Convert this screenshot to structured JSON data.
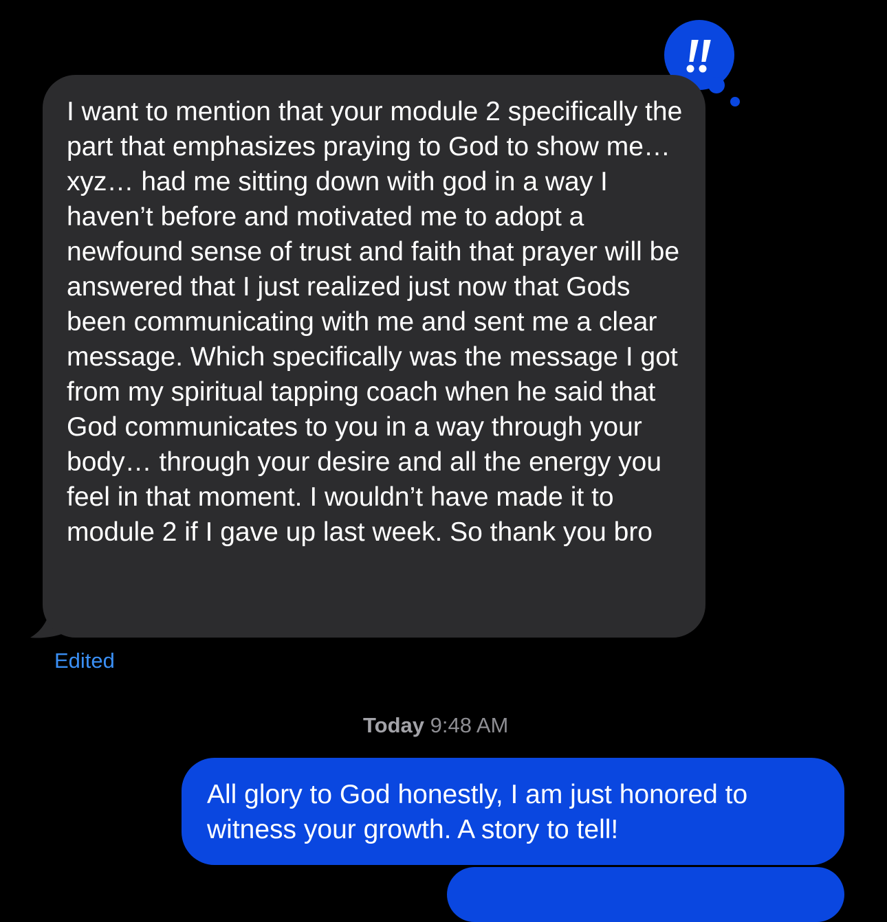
{
  "conversation": {
    "incoming_message": {
      "text": "I want to mention that your module 2 specifically the part that emphasizes praying to God to show me… xyz… had me sitting down with god in a way I haven’t before and motivated me to adopt a newfound sense of trust and faith that prayer will be answered that I just realized just now that Gods been communicating with me and sent me a clear message. Which specifically was the message I got from my spiritual tapping coach when he said that God communicates to you in a way through your body… through your desire and all the energy you feel in that moment. I wouldn’t have made it to module 2 if I gave up last week. So thank you bro",
      "bubble_color": "#2c2c2e",
      "reaction": {
        "icon": "double-exclamation-icon",
        "color": "#0a47e0"
      },
      "edited_label": "Edited",
      "edited_color": "#3a8ff5"
    },
    "timestamp": {
      "day": "Today",
      "time": "9:48 AM"
    },
    "outgoing_message": {
      "text": "All glory to God honestly, I am just honored to witness your growth. A story to tell!",
      "bubble_color": "#0a47e0"
    }
  }
}
